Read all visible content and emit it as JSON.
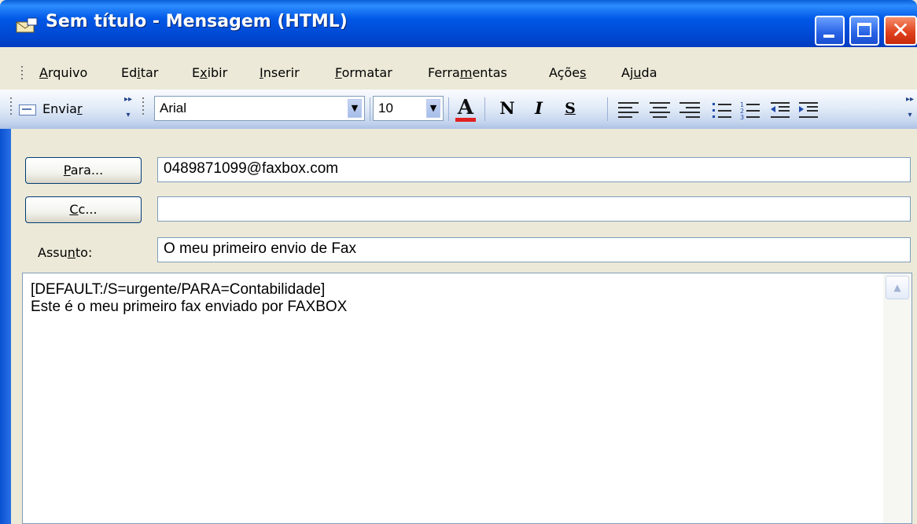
{
  "window": {
    "title": "Sem título - Mensagem (HTML)",
    "controls": {
      "minimize": "minimize-icon",
      "maximize": "maximize-icon",
      "close": "close-icon"
    }
  },
  "menu": {
    "items": [
      {
        "pre": "",
        "key": "A",
        "post": "rquivo"
      },
      {
        "pre": "Ed",
        "key": "i",
        "post": "tar"
      },
      {
        "pre": "E",
        "key": "x",
        "post": "ibir"
      },
      {
        "pre": "",
        "key": "I",
        "post": "nserir"
      },
      {
        "pre": "",
        "key": "F",
        "post": "ormatar"
      },
      {
        "pre": "Ferra",
        "key": "m",
        "post": "entas"
      },
      {
        "pre": "Açõe",
        "key": "s",
        "post": ""
      },
      {
        "pre": "Aj",
        "key": "u",
        "post": "da"
      }
    ]
  },
  "toolbar": {
    "send": {
      "pre": "Envia",
      "key": "r",
      "post": ""
    },
    "font_name": "Arial",
    "font_size": "10",
    "font_color_glyph": "A",
    "bold_glyph": "N",
    "italic_glyph": "I",
    "underline_glyph": "S",
    "accent_color": "#e02020"
  },
  "header_fields": {
    "to": {
      "btn_key": "P",
      "btn_post": "ara...",
      "value": "0489871099@faxbox.com"
    },
    "cc": {
      "btn_key": "C",
      "btn_post": "c...",
      "value": ""
    },
    "subject": {
      "label_pre": "Assu",
      "label_key": "n",
      "label_post": "to:",
      "value": "O meu primeiro envio de Fax"
    }
  },
  "body": {
    "lines": [
      "[DEFAULT:/S=urgente/PARA=Contabilidade]",
      "Este é o meu primeiro fax enviado por FAXBOX"
    ]
  }
}
